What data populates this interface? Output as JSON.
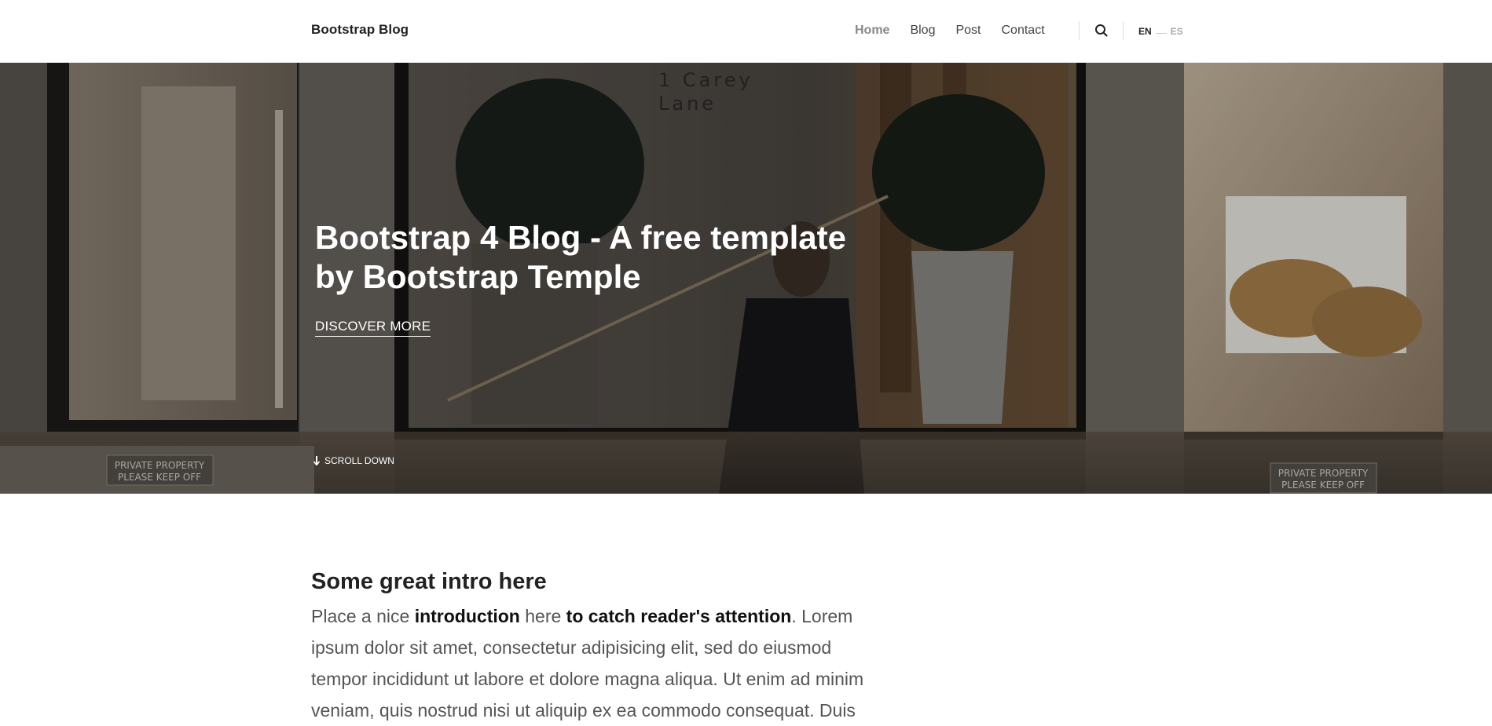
{
  "navbar": {
    "brand": "Bootstrap Blog",
    "links": [
      {
        "label": "Home",
        "active": true
      },
      {
        "label": "Blog",
        "active": false
      },
      {
        "label": "Post",
        "active": false
      },
      {
        "label": "Contact",
        "active": false
      }
    ],
    "search_icon": "search-icon",
    "lang_active": "EN",
    "lang_other": "ES"
  },
  "hero": {
    "title": "Bootstrap 4 Blog - A free template by Bootstrap Temple",
    "link_label": "DISCOVER MORE",
    "scroll_label": "SCROLL DOWN",
    "scroll_icon": "arrow-down-icon",
    "sign_text_1": "1 Carey",
    "sign_text_2": "Lane",
    "private_sign_line1": "PRIVATE PROPERTY",
    "private_sign_line2": "PLEASE KEEP OFF"
  },
  "intro": {
    "heading": "Some great intro here",
    "text_part1": "Place a nice ",
    "text_bold1": "introduction",
    "text_part2": " here ",
    "text_bold2": "to catch reader's attention",
    "text_part3": ". Lorem ipsum dolor sit amet, consectetur adipisicing elit, sed do eiusmod tempor incididunt ut labore et dolore magna aliqua. Ut enim ad minim veniam, quis nostrud nisi ut aliquip ex ea commodo consequat. Duis"
  },
  "colors": {
    "accent": "#222222",
    "nav_active": "#888888"
  }
}
